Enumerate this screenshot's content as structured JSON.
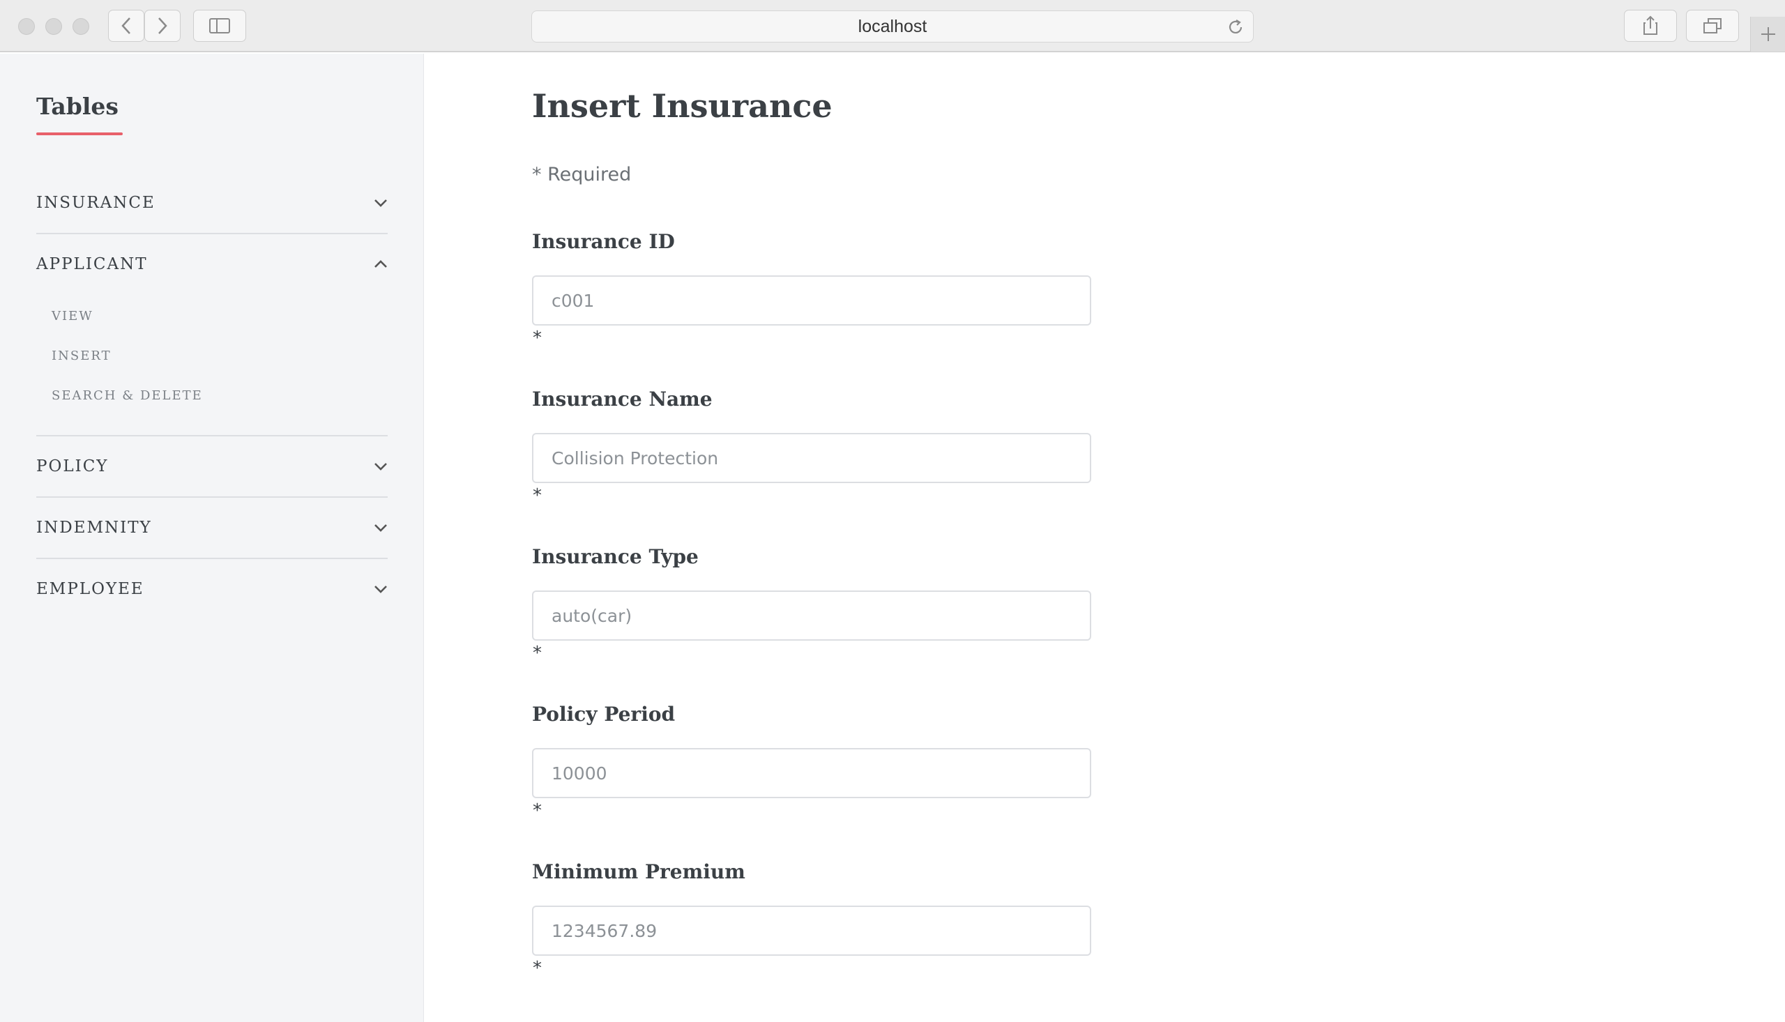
{
  "browser": {
    "url": "localhost"
  },
  "sidebar": {
    "title": "Tables",
    "sections": [
      {
        "label": "INSURANCE",
        "expanded": false
      },
      {
        "label": "APPLICANT",
        "expanded": true,
        "items": [
          "VIEW",
          "INSERT",
          "SEARCH & DELETE"
        ]
      },
      {
        "label": "POLICY",
        "expanded": false
      },
      {
        "label": "INDEMNITY",
        "expanded": false
      },
      {
        "label": "EMPLOYEE",
        "expanded": false
      }
    ]
  },
  "form": {
    "title": "Insert Insurance",
    "required_note": "* Required",
    "required_marker": "*",
    "fields": [
      {
        "label": "Insurance ID",
        "value": "",
        "placeholder": "c001"
      },
      {
        "label": "Insurance Name",
        "value": "",
        "placeholder": "Collision Protection"
      },
      {
        "label": "Insurance Type",
        "value": "",
        "placeholder": "auto(car)"
      },
      {
        "label": "Policy Period",
        "value": "",
        "placeholder": "10000"
      },
      {
        "label": "Minimum Premium",
        "value": "",
        "placeholder": "1234567.89"
      }
    ]
  },
  "colors": {
    "accent": "#e8606a",
    "sidebar_bg": "#f4f5f7",
    "text": "#3b4045"
  }
}
